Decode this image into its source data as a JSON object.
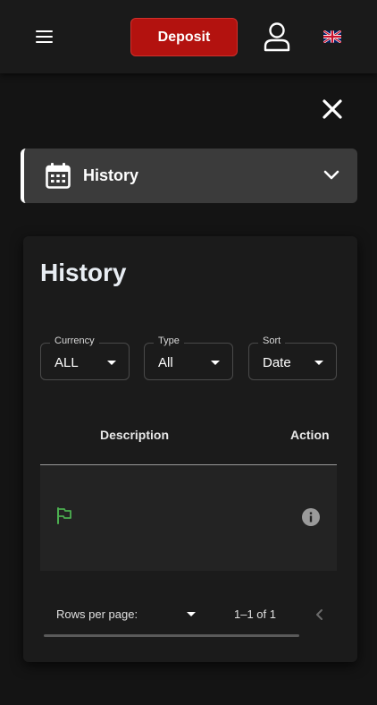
{
  "topbar": {
    "deposit_label": "Deposit",
    "icons": [
      "menu-icon",
      "user-icon",
      "uk-flag-icon"
    ]
  },
  "section": {
    "title": "History",
    "icon": "calendar-icon"
  },
  "panel": {
    "title": "History",
    "filters": [
      {
        "label": "Currency",
        "value": "ALL"
      },
      {
        "label": "Type",
        "value": "All"
      },
      {
        "label": "Sort",
        "value": "Date"
      }
    ],
    "columns": [
      "Description",
      "Action"
    ],
    "rows": [
      {
        "status_icon": "flag-icon",
        "action_icon": "info-icon"
      }
    ],
    "pagination": {
      "rows_per_page_label": "Rows per page:",
      "page_info": "1–1 of 1"
    }
  },
  "colors": {
    "background": "#141414",
    "topbar": "#1a1a1a",
    "deposit": "#b3120f",
    "section_header": "#3b3b3b",
    "panel": "#1b1b1b",
    "status_flag": "#4caf50"
  }
}
